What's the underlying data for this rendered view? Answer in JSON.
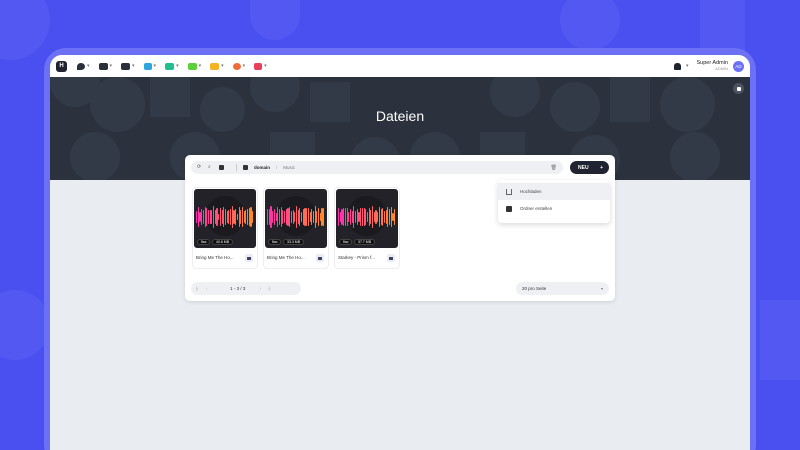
{
  "colors": {
    "accent": "#4a4ff0",
    "dark": "#1f2430",
    "wave_pink": "#ff2fb0",
    "wave_orange": "#ff8a2a"
  },
  "topbar": {
    "logo": "H",
    "nav_icons": [
      "location-icon",
      "users-icon",
      "folder-icon",
      "edit-icon",
      "flag-icon",
      "chat-icon",
      "stack-icon",
      "palette-icon",
      "document-icon"
    ],
    "user_name": "Super Admin",
    "user_role": "ADMIN",
    "avatar_initials": "AD"
  },
  "hero": {
    "title": "Dateien"
  },
  "toolbar": {
    "crumb_root": "domain",
    "crumb_sep": "/",
    "crumb_current": "Music",
    "new_label": "NEU",
    "new_icon": "+"
  },
  "files": [
    {
      "name": "Bring Me The Ho...",
      "format": "flac",
      "size": "40.6 MB"
    },
    {
      "name": "Bring Me The Ho...",
      "format": "flac",
      "size": "33.3 MB"
    },
    {
      "name": "Starkey - Prism f...",
      "format": "flac",
      "size": "37.7 MB"
    }
  ],
  "pager": {
    "first": "|‹",
    "prev": "‹",
    "count": "1 - 3 / 3",
    "next": "›",
    "last": "›|"
  },
  "per_page": {
    "value": "20 pro Seite"
  },
  "dropdown": {
    "upload": "Hochladen",
    "create_folder": "Ordner erstellen"
  }
}
